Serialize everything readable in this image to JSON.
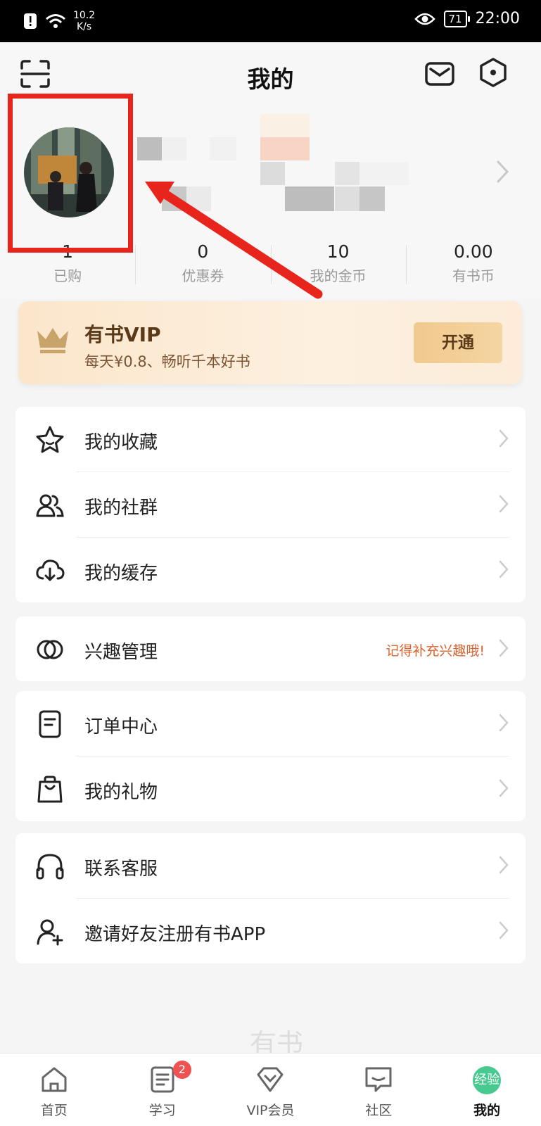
{
  "status_bar": {
    "speed_top": "10.2",
    "speed_bottom": "K/s",
    "battery": "71",
    "time": "22:00"
  },
  "header": {
    "title": "我的"
  },
  "stats": [
    {
      "value": "1",
      "label": "已购"
    },
    {
      "value": "0",
      "label": "优惠券"
    },
    {
      "value": "10",
      "label": "我的金币"
    },
    {
      "value": "0.00",
      "label": "有书币"
    }
  ],
  "vip": {
    "title": "有书VIP",
    "subtitle": "每天¥0.8、畅听千本好书",
    "button": "开通"
  },
  "menu": {
    "favorites": "我的收藏",
    "community": "我的社群",
    "cache": "我的缓存",
    "interests": "兴趣管理",
    "interests_hint": "记得补充兴趣哦!",
    "orders": "订单中心",
    "gifts": "我的礼物",
    "support": "联系客服",
    "invite": "邀请好友注册有书APP"
  },
  "watermark": "有书",
  "tabs": [
    {
      "label": "首页"
    },
    {
      "label": "学习",
      "badge": "2"
    },
    {
      "label": "VIP会员"
    },
    {
      "label": "社区"
    },
    {
      "label": "我的",
      "dot": "经验"
    }
  ],
  "colors": {
    "accent": "#48c990",
    "highlight": "#e8251d",
    "hint": "#d9632e"
  }
}
